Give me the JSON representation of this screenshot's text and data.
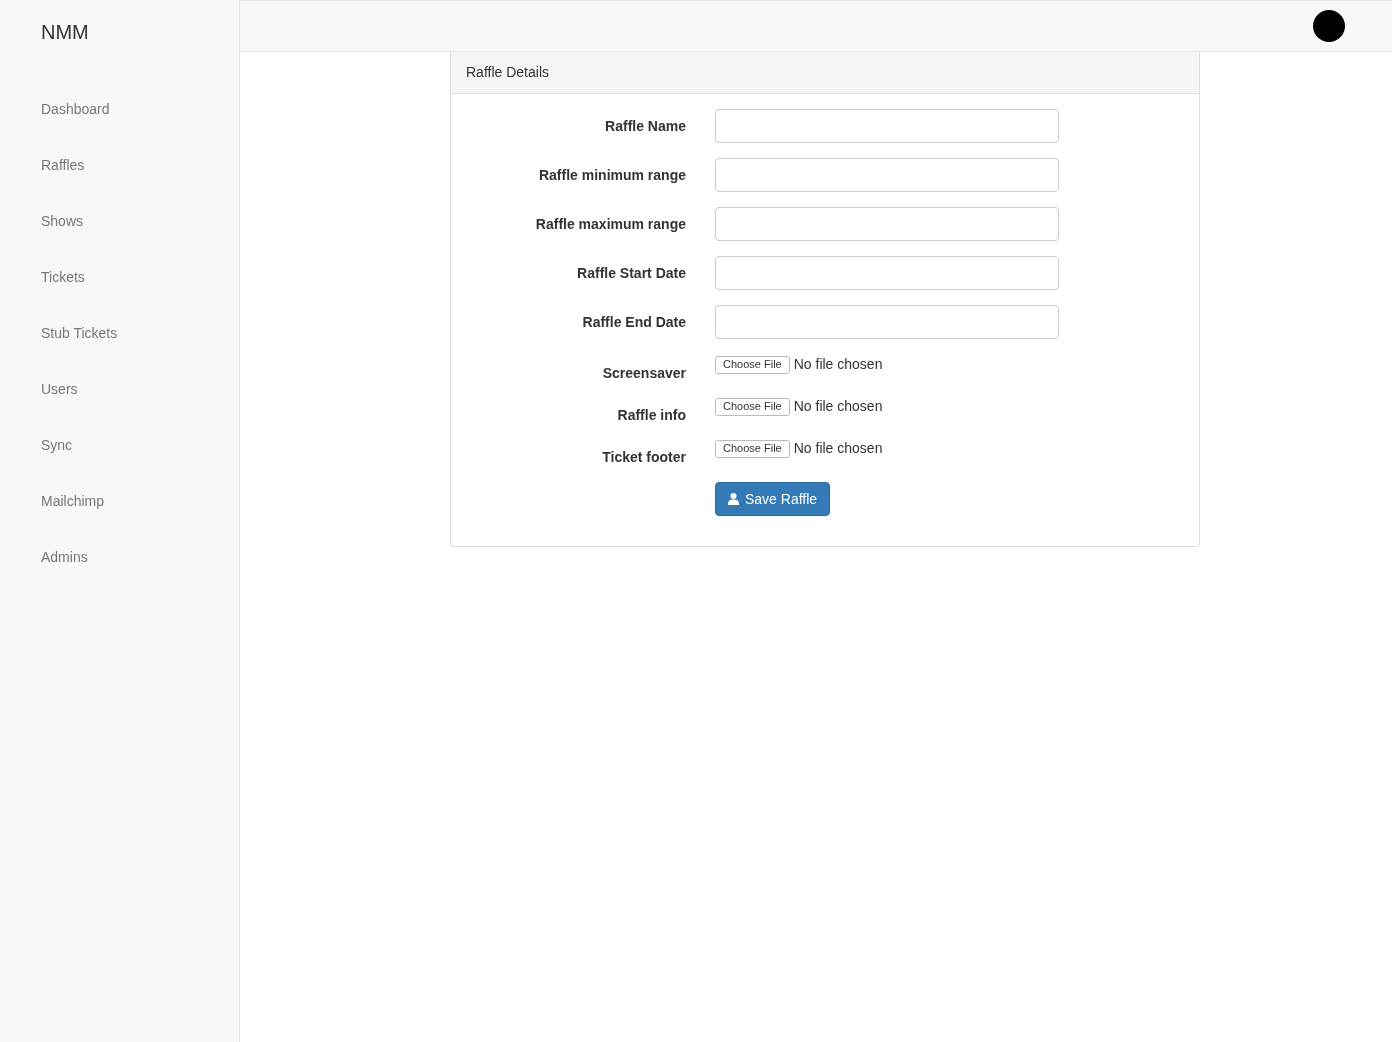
{
  "brand": "NMM",
  "nav": [
    {
      "label": "Dashboard"
    },
    {
      "label": "Raffles"
    },
    {
      "label": "Shows"
    },
    {
      "label": "Tickets"
    },
    {
      "label": "Stub Tickets"
    },
    {
      "label": "Users"
    },
    {
      "label": "Sync"
    },
    {
      "label": "Mailchimp"
    },
    {
      "label": "Admins"
    }
  ],
  "panel": {
    "title": "Raffle Details",
    "fields": [
      {
        "kind": "text",
        "label": "Raffle Name"
      },
      {
        "kind": "text",
        "label": "Raffle minimum range"
      },
      {
        "kind": "text",
        "label": "Raffle maximum range"
      },
      {
        "kind": "text",
        "label": "Raffle Start Date"
      },
      {
        "kind": "text",
        "label": "Raffle End Date"
      },
      {
        "kind": "file",
        "label": "Screensaver",
        "button": "Choose File",
        "status": "No file chosen"
      },
      {
        "kind": "file",
        "label": "Raffle info",
        "button": "Choose File",
        "status": "No file chosen"
      },
      {
        "kind": "file",
        "label": "Ticket footer",
        "button": "Choose File",
        "status": "No file chosen"
      }
    ],
    "submit": "Save Raffle"
  }
}
